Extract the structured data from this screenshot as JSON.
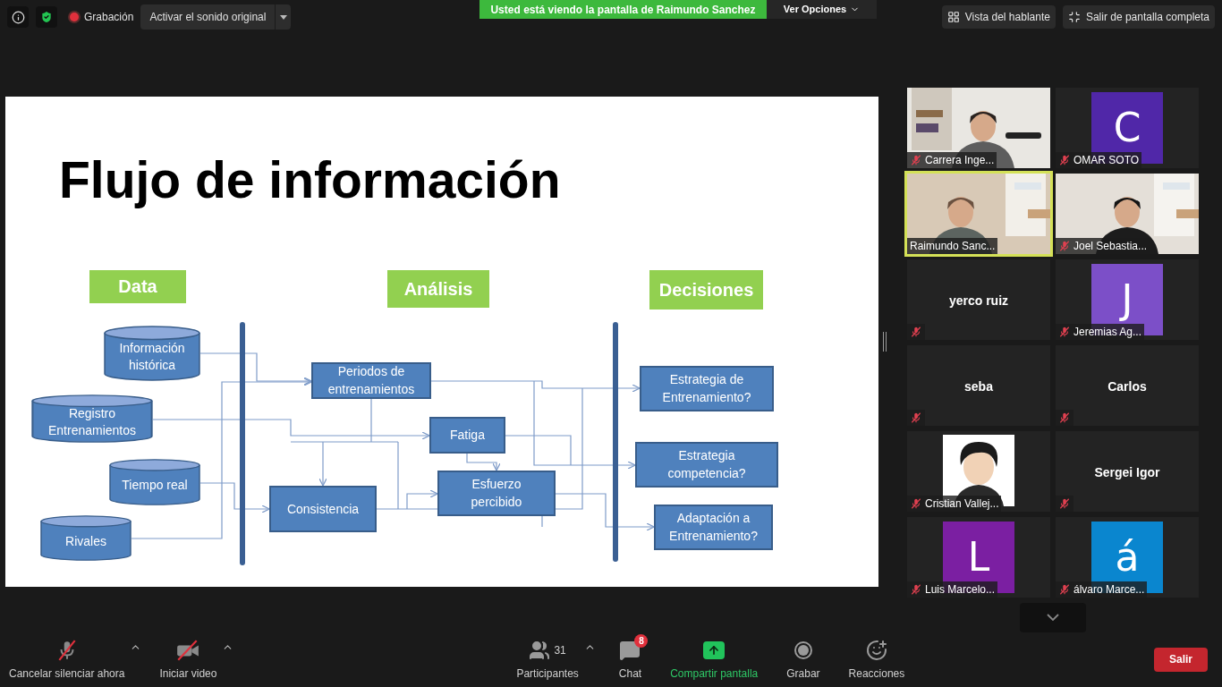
{
  "top_bar": {
    "recording_label": "Grabación",
    "audio_dropdown": "Activar el sonido original",
    "share_banner": "Usted está viendo la pantalla de Raimundo Sanchez",
    "view_options": "Ver Opciones",
    "speaker_view": "Vista del hablante",
    "exit_fullscreen": "Salir de pantalla completa"
  },
  "slide": {
    "title": "Flujo de información",
    "headers": [
      "Data",
      "Análisis",
      "Decisiones"
    ],
    "nodes": [
      {
        "label": "Información histórica",
        "kind": "database"
      },
      {
        "label": "Registro Entrenamientos",
        "kind": "database"
      },
      {
        "label": "Tiempo real",
        "kind": "database"
      },
      {
        "label": "Rivales",
        "kind": "database"
      },
      {
        "label": "Periodos de entrenamientos",
        "kind": "process"
      },
      {
        "label": "Fatiga",
        "kind": "process"
      },
      {
        "label": "Consistencia",
        "kind": "process"
      },
      {
        "label": "Esfuerzo percibido",
        "kind": "process"
      },
      {
        "label": "Estrategia de Entrenamiento?",
        "kind": "process"
      },
      {
        "label": "Estrategia competencia?",
        "kind": "process"
      },
      {
        "label": "Adaptación a Entrenamiento?",
        "kind": "process"
      }
    ]
  },
  "gallery": {
    "tiles": [
      {
        "name": "Carrera Inge...",
        "kind": "video",
        "muted": true,
        "speaking": false
      },
      {
        "name": "OMAR SOTO",
        "kind": "avatar",
        "letter": "C",
        "color": "#5027a8",
        "muted": true,
        "speaking": false
      },
      {
        "name": "Raimundo Sanc...",
        "kind": "video",
        "muted": false,
        "speaking": true
      },
      {
        "name": "Joel Sebastia...",
        "kind": "video",
        "muted": true,
        "speaking": false
      },
      {
        "name": "yerco ruiz",
        "kind": "name",
        "muted": true,
        "speaking": false
      },
      {
        "name": "Jeremias Ag...",
        "kind": "avatar",
        "letter": "J",
        "color": "#7c4fc8",
        "muted": true,
        "speaking": false
      },
      {
        "name": "seba",
        "kind": "name",
        "muted": true,
        "speaking": false
      },
      {
        "name": "Carlos",
        "kind": "name",
        "muted": true,
        "speaking": false
      },
      {
        "name": "Cristian Vallej...",
        "kind": "picture",
        "muted": true,
        "speaking": false
      },
      {
        "name": "Sergei Igor",
        "kind": "name",
        "muted": true,
        "speaking": false
      },
      {
        "name": "Luis Marcelo...",
        "kind": "avatar",
        "letter": "L",
        "color": "#7b1fa2",
        "muted": true,
        "speaking": false
      },
      {
        "name": "álvaro Marce...",
        "kind": "avatar",
        "letter": "á",
        "color": "#0a86cf",
        "muted": true,
        "speaking": false
      }
    ]
  },
  "toolbar": {
    "items": [
      {
        "label": "Cancelar silenciar ahora",
        "kind": "mic",
        "caret": true
      },
      {
        "label": "Iniciar video",
        "kind": "video",
        "caret": true
      },
      {
        "label": "Participantes",
        "kind": "participants",
        "count": "31",
        "caret": true
      },
      {
        "label": "Chat",
        "kind": "chat",
        "badge": "8",
        "caret": false
      },
      {
        "label": "Compartir pantalla",
        "kind": "share",
        "caret": false
      },
      {
        "label": "Grabar",
        "kind": "record",
        "caret": false
      },
      {
        "label": "Reacciones",
        "kind": "reactions",
        "caret": false
      }
    ],
    "leave": "Salir"
  }
}
